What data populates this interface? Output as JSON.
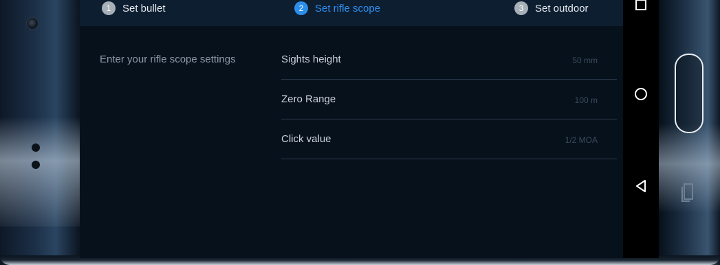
{
  "stepper": {
    "steps": [
      {
        "num": "1",
        "label": "Set bullet"
      },
      {
        "num": "2",
        "label": "Set rifle scope"
      },
      {
        "num": "3",
        "label": "Set outdoor"
      }
    ],
    "active_step": 2
  },
  "content": {
    "intro": "Enter your rifle scope settings",
    "settings": [
      {
        "label": "Sights height",
        "value": "50 mm"
      },
      {
        "label": "Zero Range",
        "value": "100 m"
      },
      {
        "label": "Click value",
        "value": "1/2 MOA"
      }
    ]
  },
  "navbar": {
    "buttons": [
      "recents-icon",
      "home-icon",
      "back-icon"
    ]
  },
  "colors": {
    "accent": "#2e8ff0",
    "screen_bg": "#07111c",
    "header_bg": "#0d1e30"
  }
}
